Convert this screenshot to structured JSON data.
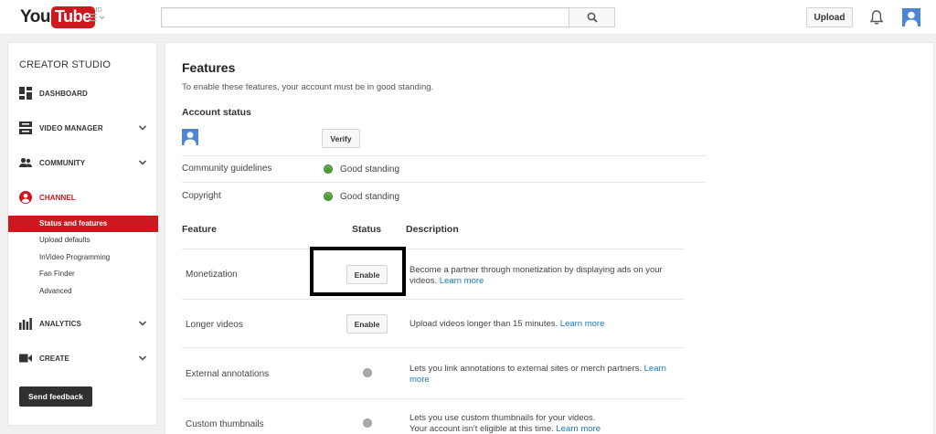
{
  "header": {
    "logo_you": "You",
    "logo_tube": "Tube",
    "logo_region": "ID",
    "search_value": "",
    "upload_label": "Upload"
  },
  "sidebar": {
    "title": "CREATOR STUDIO",
    "items": [
      {
        "label": "DASHBOARD",
        "icon": "dashboard-icon"
      },
      {
        "label": "VIDEO MANAGER",
        "icon": "video-manager-icon"
      },
      {
        "label": "COMMUNITY",
        "icon": "community-icon"
      },
      {
        "label": "CHANNEL",
        "icon": "channel-icon"
      },
      {
        "label": "ANALYTICS",
        "icon": "analytics-icon"
      },
      {
        "label": "CREATE",
        "icon": "create-icon"
      }
    ],
    "channel_sub": [
      "Status and features",
      "Upload defaults",
      "InVideo Programming",
      "Fan Finder",
      "Advanced"
    ],
    "feedback_label": "Send feedback"
  },
  "main": {
    "title": "Features",
    "intro": "To enable these features, your account must be in good standing.",
    "account_status_heading": "Account status",
    "verify_label": "Verify",
    "status_rows": [
      {
        "label": "Community guidelines",
        "status": "Good standing"
      },
      {
        "label": "Copyright",
        "status": "Good standing"
      }
    ],
    "columns": {
      "feature": "Feature",
      "status": "Status",
      "description": "Description"
    },
    "features": [
      {
        "name": "Monetization",
        "action": "Enable",
        "desc": "Become a partner through monetization by displaying ads on your videos.",
        "link": "Learn more"
      },
      {
        "name": "Longer videos",
        "action": "Enable",
        "desc": "Upload videos longer than 15 minutes.",
        "link": "Learn more"
      },
      {
        "name": "External annotations",
        "desc": "Lets you link annotations to external sites or merch partners.",
        "link": "Learn more"
      },
      {
        "name": "Custom thumbnails",
        "desc": "Lets you use custom thumbnails for your videos.",
        "desc2": "Your account isn't eligible at this time.",
        "link": "Learn more"
      }
    ]
  },
  "colors": {
    "brand_red": "#cc181e",
    "link_blue": "#167ac6",
    "good_green": "#4b9b32"
  }
}
